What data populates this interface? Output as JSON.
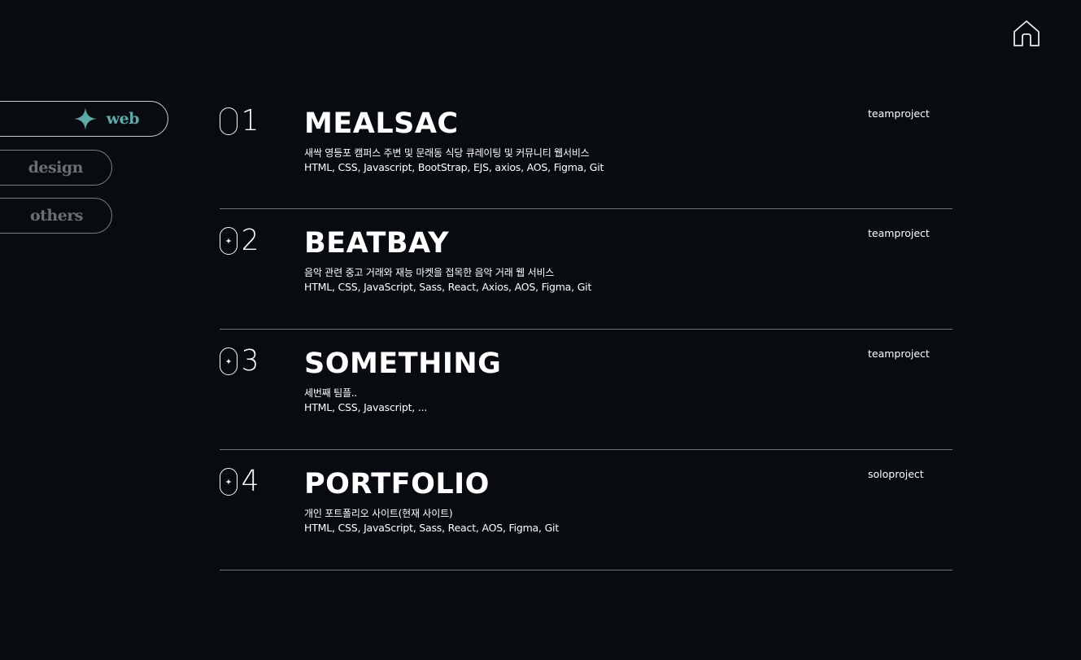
{
  "header": {
    "home_icon": "home-icon"
  },
  "side_nav": {
    "items": [
      {
        "label": "web",
        "active": true,
        "icon": "sparkle-icon",
        "color": "#5fa9a6"
      },
      {
        "label": "design",
        "active": false
      },
      {
        "label": "others",
        "active": false
      }
    ]
  },
  "projects": [
    {
      "num_tail": "1",
      "title": "MEALSAC",
      "description": "새싹 영등포 캠퍼스 주변 및 문래동 식당 큐레이팅 및 커뮤니티 웹서비스",
      "stack": "HTML, CSS, Javascript, BootStrap, EJS, axios, AOS, Figma, Git",
      "type": "teamproject"
    },
    {
      "num_tail": "2",
      "title": "BEATBAY",
      "description": "음악 관련 중고 거래와 재능 마켓을 접목한 음악 거래 웹 서비스",
      "stack": "HTML, CSS, JavaScript, Sass, React, Axios, AOS, Figma, Git",
      "type": "teamproject"
    },
    {
      "num_tail": "3",
      "title": "SOMETHING",
      "description": "세번째 팀플..",
      "stack": "HTML, CSS, Javascript, ...",
      "type": "teamproject"
    },
    {
      "num_tail": "4",
      "title": "PORTFOLIO",
      "description": "개인 포트폴리오 사이트(현재 사이트)",
      "stack": "HTML, CSS, JavaScript, Sass, React, AOS, Figma, Git",
      "type": "soloproject"
    }
  ],
  "colors": {
    "background": "#080b0f",
    "accent": "#5fa9a6",
    "muted": "#6b6f73",
    "divider": "#6e7276"
  }
}
